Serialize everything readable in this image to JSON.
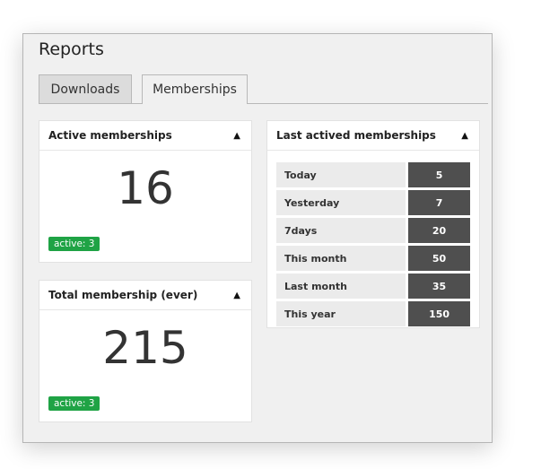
{
  "window": {
    "title": "Reports"
  },
  "tabs": [
    {
      "label": "Downloads",
      "active": false
    },
    {
      "label": "Memberships",
      "active": true
    }
  ],
  "cards": {
    "active_memberships": {
      "title": "Active memberships",
      "toggle_icon": "triangle-up-icon",
      "value": "16",
      "badge": "active: 3"
    },
    "total_membership": {
      "title": "Total membership (ever)",
      "toggle_icon": "triangle-up-icon",
      "value": "215",
      "badge": "active: 3"
    },
    "last_actived": {
      "title": "Last actived memberships",
      "toggle_icon": "triangle-up-icon",
      "rows": [
        {
          "label": "Today",
          "value": "5"
        },
        {
          "label": "Yesterday",
          "value": "7"
        },
        {
          "label": "7days",
          "value": "20"
        },
        {
          "label": "This month",
          "value": "50"
        },
        {
          "label": "Last month",
          "value": "35"
        },
        {
          "label": "This year",
          "value": "150"
        }
      ]
    }
  },
  "colors": {
    "badge": "#1fa345",
    "value_cell": "#4f4f4f",
    "label_cell": "#ebebeb"
  }
}
